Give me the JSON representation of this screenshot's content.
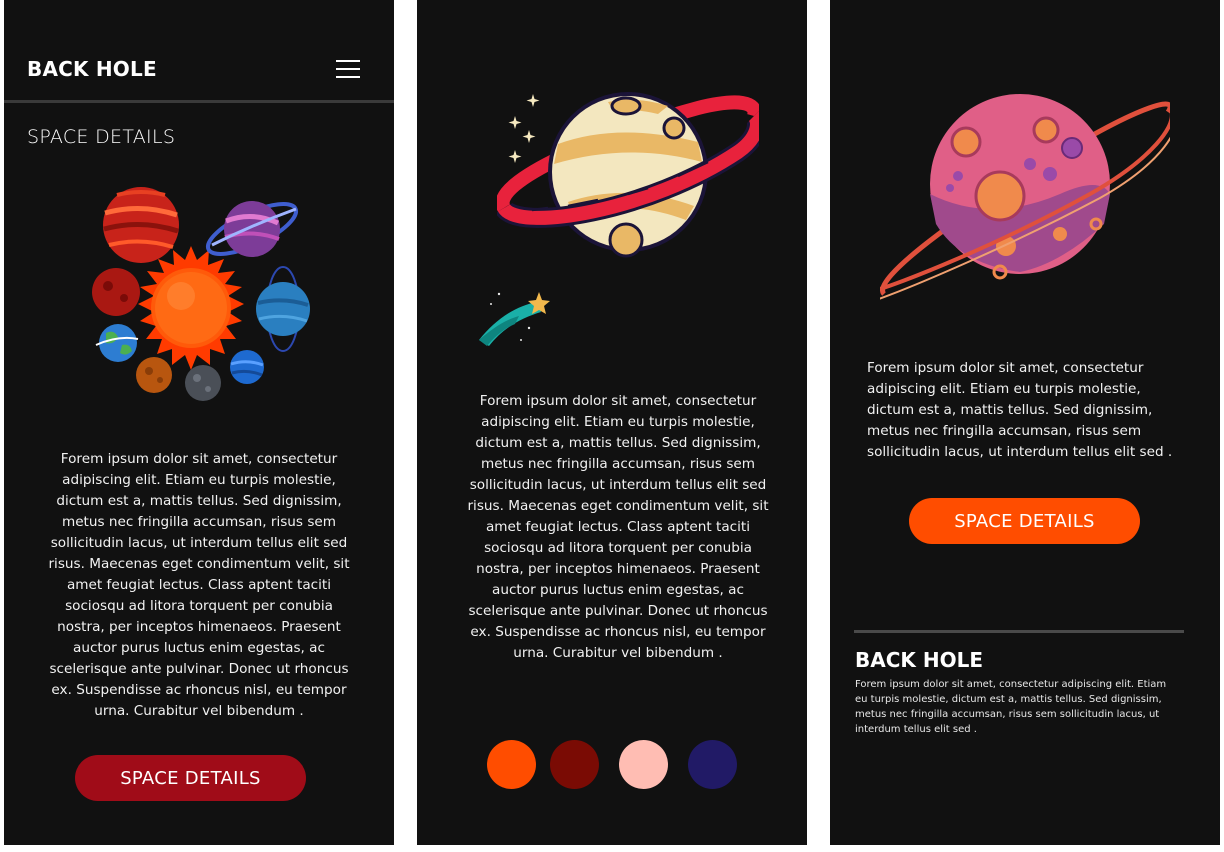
{
  "screen1": {
    "brand": "BACK HOLE",
    "section_title": "SPACE DETAILS",
    "body_text": "Forem ipsum dolor sit amet, consectetur adipiscing elit. Etiam eu turpis molestie, dictum est a, mattis tellus. Sed dignissim, metus nec fringilla accumsan, risus sem sollicitudin lacus, ut interdum tellus elit sed risus. Maecenas eget condimentum velit, sit amet feugiat lectus. Class aptent taciti sociosqu ad litora torquent per conubia nostra, per inceptos himenaeos. Praesent auctor purus luctus enim egestas, ac scelerisque ante pulvinar. Donec ut rhoncus ex. Suspendisse ac rhoncus nisl, eu tempor urna. Curabitur vel bibendum .",
    "button_label": "SPACE DETAILS",
    "button_color": "#a00c18"
  },
  "screen2": {
    "body_text": "Forem ipsum dolor sit amet, consectetur adipiscing elit. Etiam eu turpis molestie, dictum est a, mattis tellus. Sed dignissim, metus nec fringilla accumsan, risus sem sollicitudin lacus, ut interdum tellus elit sed risus. Maecenas eget condimentum velit, sit amet feugiat lectus. Class aptent taciti sociosqu ad litora torquent per conubia nostra, per inceptos himenaeos. Praesent auctor purus luctus enim egestas, ac scelerisque ante pulvinar. Donec ut rhoncus ex. Suspendisse ac rhoncus nisl, eu tempor urna. Curabitur vel bibendum .",
    "palette": [
      "#ff4d00",
      "#7a0b04",
      "#ffbdb3",
      "#211a66"
    ]
  },
  "screen3": {
    "body_text": "Forem ipsum dolor sit amet, consectetur adipiscing elit. Etiam eu turpis molestie, dictum est a, mattis tellus. Sed dignissim, metus nec fringilla accumsan, risus sem sollicitudin lacus, ut interdum tellus elit sed  .",
    "button_label": "SPACE DETAILS",
    "button_color": "#ff4d00",
    "footer": {
      "brand": "BACK HOLE",
      "text": "Forem ipsum dolor sit amet, consectetur adipiscing elit. Etiam eu turpis molestie, dictum est a, mattis tellus. Sed dignissim, metus nec fringilla accumsan, risus sem sollicitudin lacus, ut interdum tellus elit sed  ."
    }
  }
}
